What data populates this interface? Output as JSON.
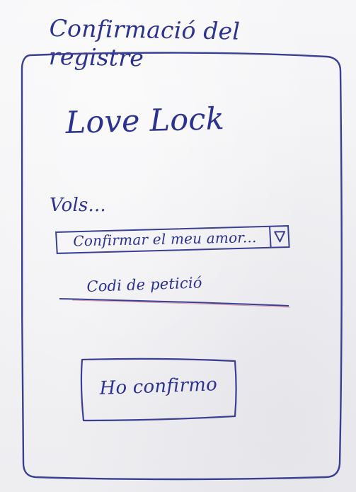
{
  "sketch": {
    "screen_title": "Confirmació del registre"
  },
  "app": {
    "title": "Love Lock"
  },
  "form": {
    "prompt": "Vols...",
    "action_select": {
      "value": "Confirmar el meu amor...",
      "arrow_icon": "chevron-down-icon"
    },
    "code_field": {
      "placeholder": "Codi de petició"
    },
    "confirm_button": {
      "label": "Ho confirmo"
    }
  },
  "colors": {
    "ink": "#2c3290",
    "paper": "#f2f2f4"
  }
}
